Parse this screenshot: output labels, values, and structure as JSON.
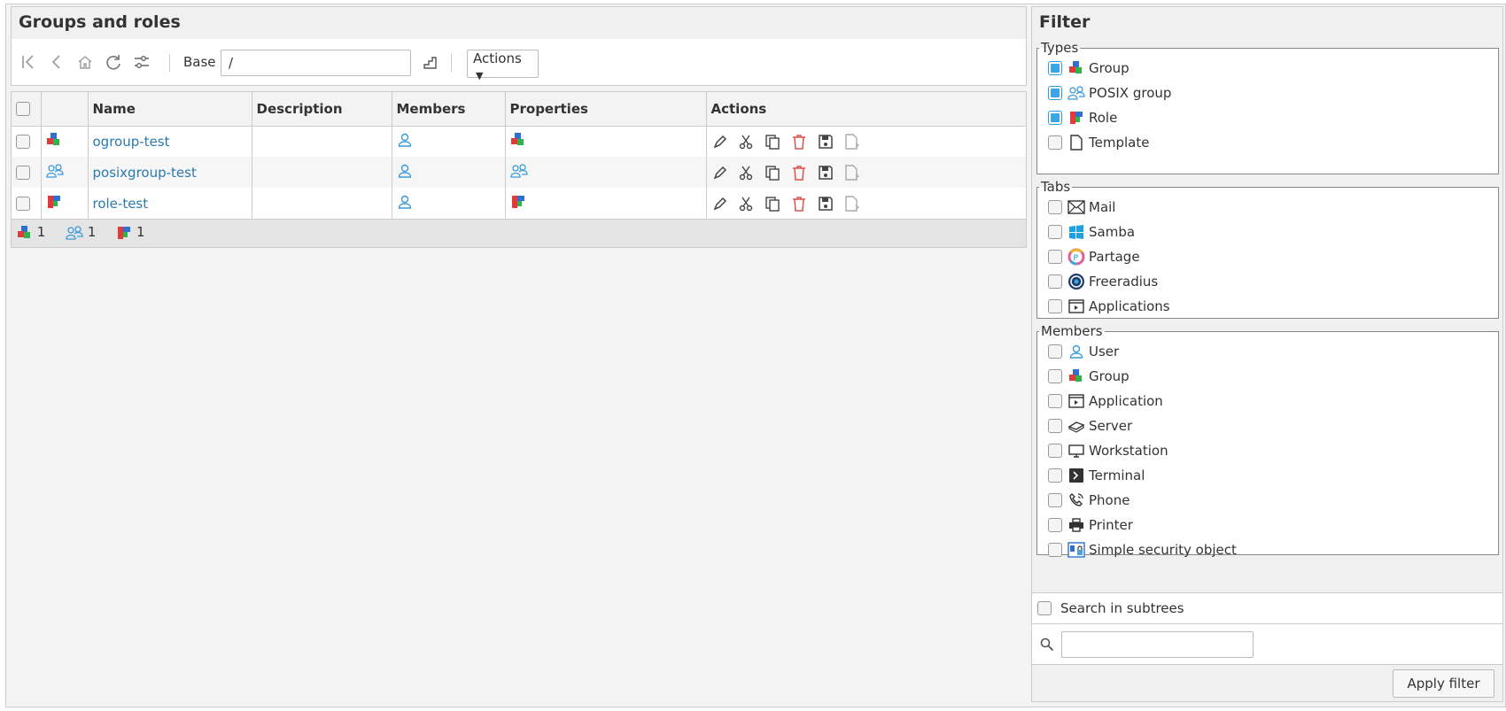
{
  "main": {
    "title": "Groups and roles",
    "base_label": "Base",
    "base_value": "/",
    "actions_label": "Actions"
  },
  "table": {
    "headers": [
      "",
      "",
      "Name",
      "Description",
      "Members",
      "Properties",
      "Actions"
    ],
    "rows": [
      {
        "name": "ogroup-test",
        "description": "",
        "type_icon": "group-icon",
        "property_icon": "group-icon"
      },
      {
        "name": "posixgroup-test",
        "description": "",
        "type_icon": "posix-group-icon",
        "property_icon": "posix-group-icon"
      },
      {
        "name": "role-test",
        "description": "",
        "type_icon": "role-icon",
        "property_icon": "role-icon"
      }
    ],
    "footer_counts": {
      "group": "1",
      "posix": "1",
      "role": "1"
    }
  },
  "filter": {
    "title": "Filter",
    "types_legend": "Types",
    "types": [
      {
        "label": "Group",
        "checked": true
      },
      {
        "label": "POSIX group",
        "checked": true
      },
      {
        "label": "Role",
        "checked": true
      },
      {
        "label": "Template",
        "checked": false
      }
    ],
    "tabs_legend": "Tabs",
    "tabs": [
      {
        "label": "Mail"
      },
      {
        "label": "Samba"
      },
      {
        "label": "Partage"
      },
      {
        "label": "Freeradius"
      },
      {
        "label": "Applications"
      }
    ],
    "members_legend": "Members",
    "members": [
      {
        "label": "User"
      },
      {
        "label": "Group"
      },
      {
        "label": "Application"
      },
      {
        "label": "Server"
      },
      {
        "label": "Workstation"
      },
      {
        "label": "Terminal"
      },
      {
        "label": "Phone"
      },
      {
        "label": "Printer"
      },
      {
        "label": "Simple security object"
      }
    ],
    "subtrees_label": "Search in subtrees",
    "search_placeholder": "",
    "apply_label": "Apply filter"
  },
  "colors": {
    "link": "#2a7ab0",
    "checked": "#3aa6e8",
    "delete_red": "#d9534f",
    "user_blue": "#3a9ad9"
  }
}
